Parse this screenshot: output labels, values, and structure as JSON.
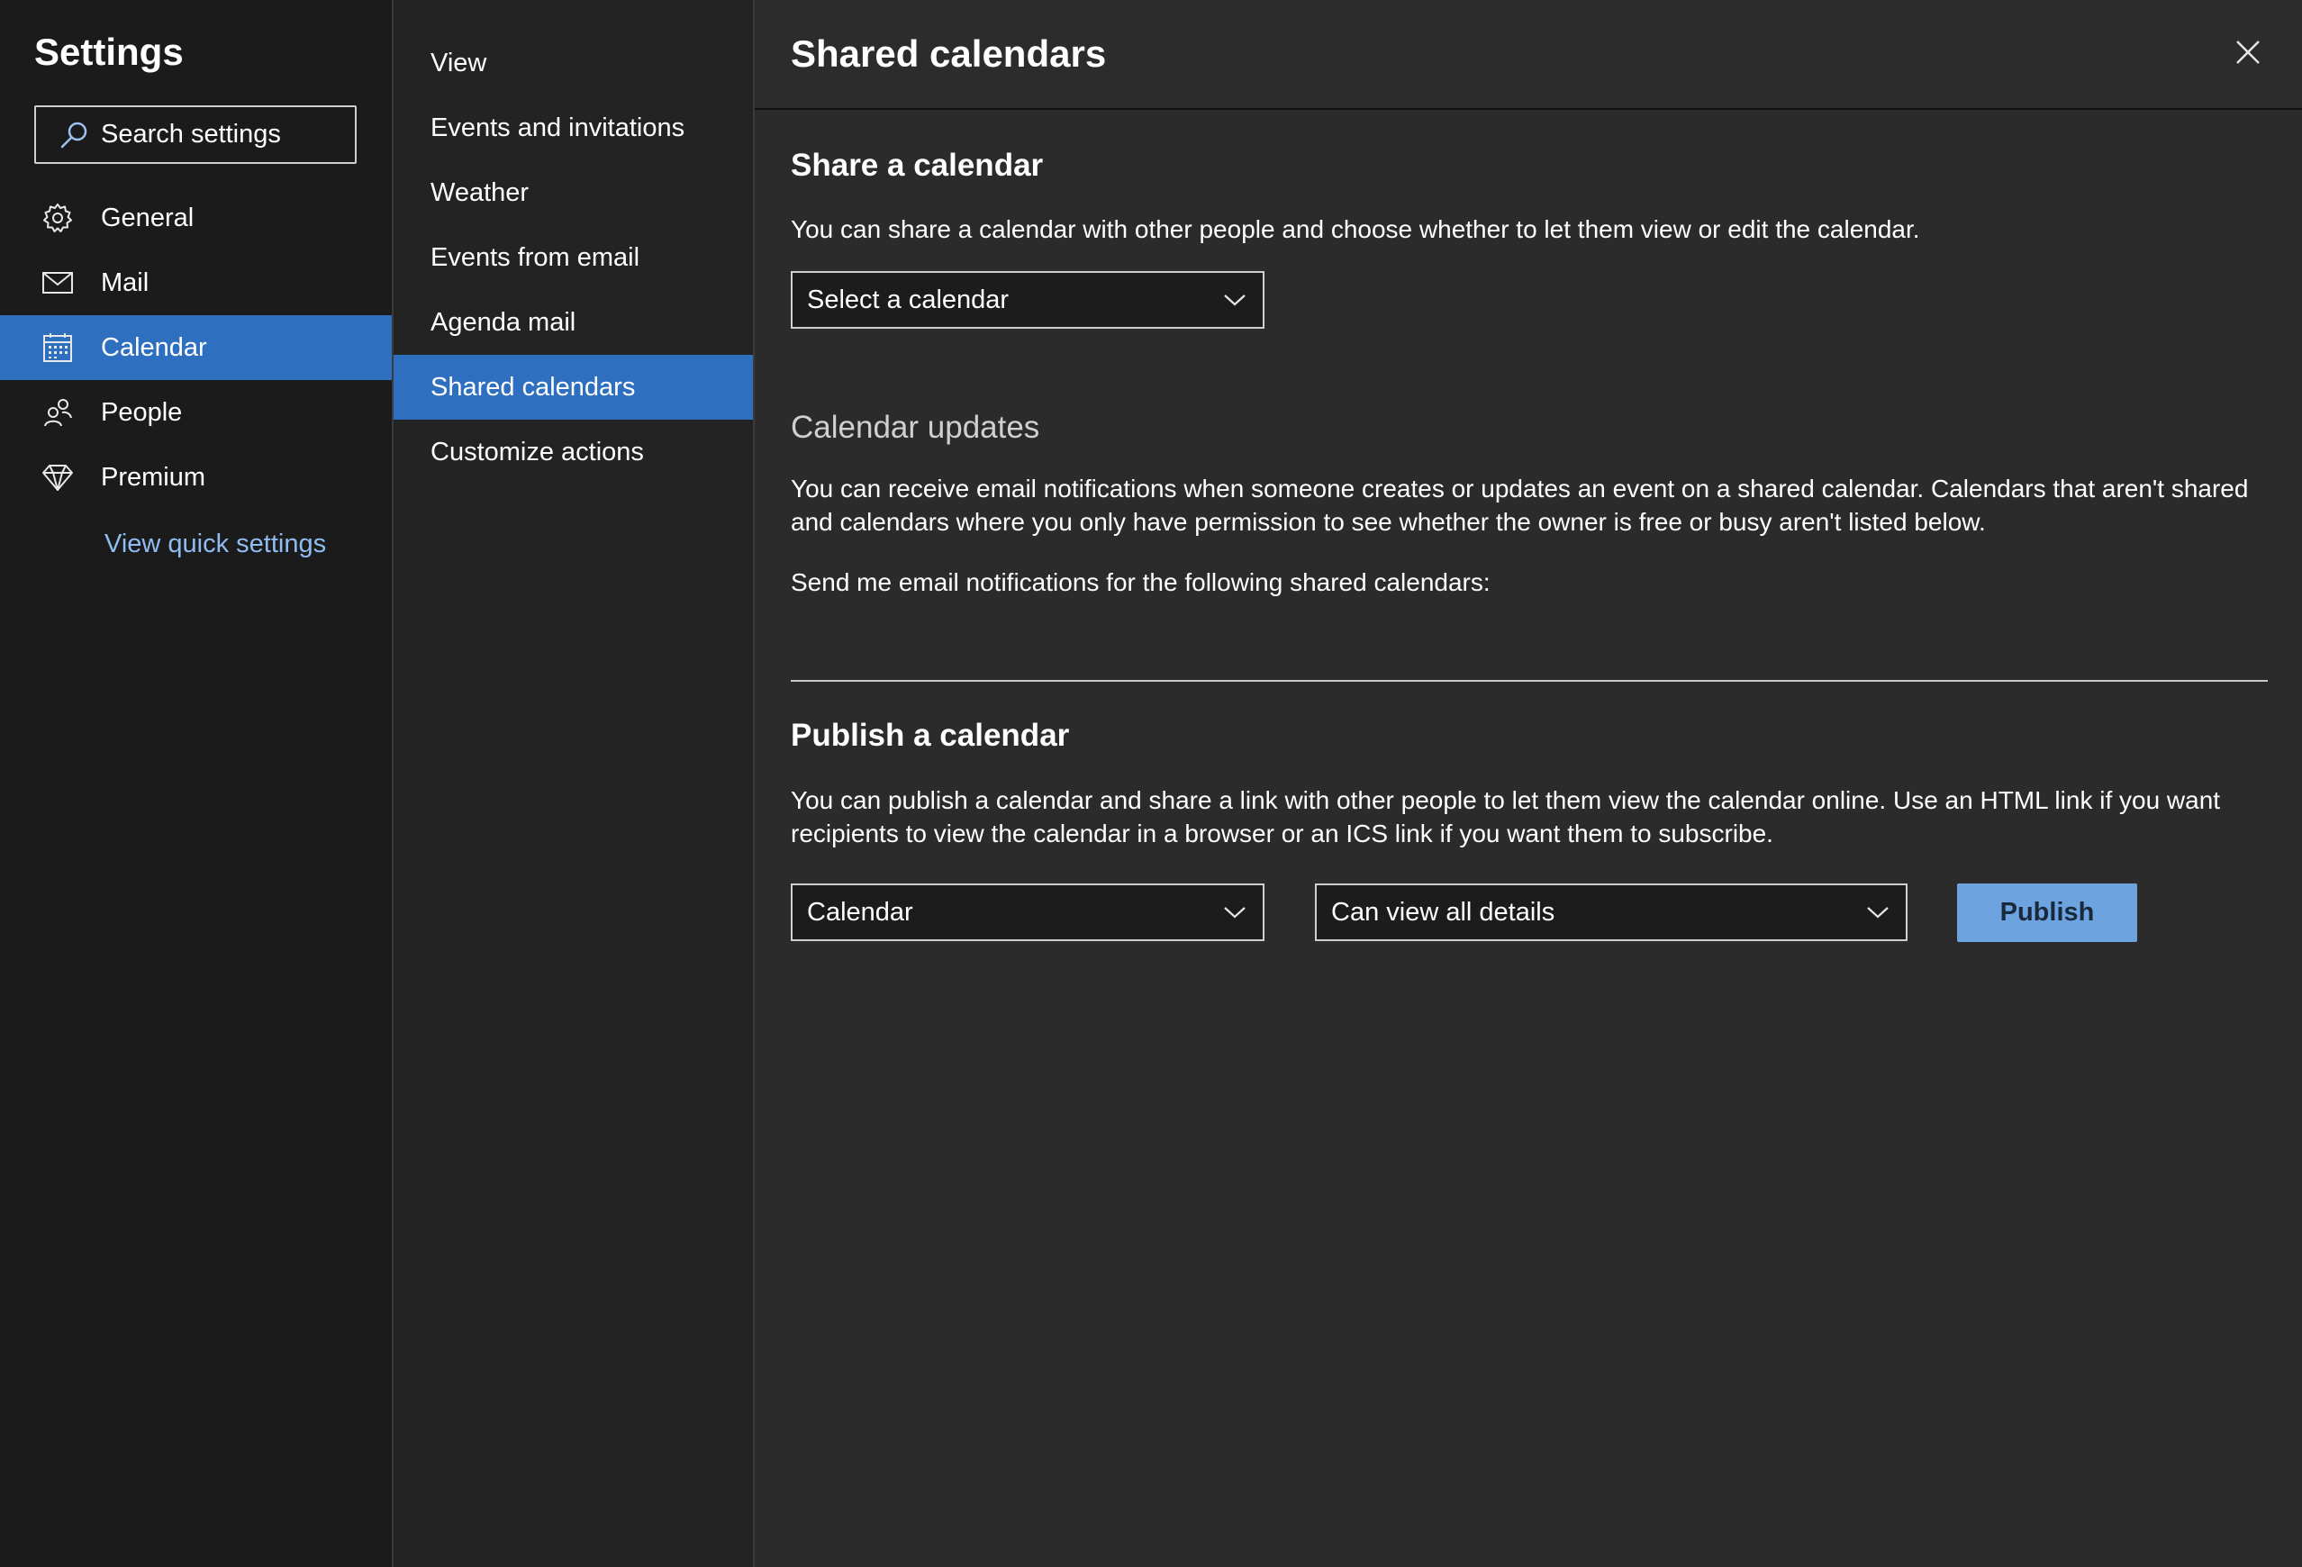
{
  "app": {
    "title": "Settings",
    "search_placeholder": "Search settings"
  },
  "nav": {
    "items": [
      {
        "label": "General",
        "icon": "gear-icon"
      },
      {
        "label": "Mail",
        "icon": "mail-icon"
      },
      {
        "label": "Calendar",
        "icon": "calendar-icon",
        "active": true
      },
      {
        "label": "People",
        "icon": "people-icon"
      },
      {
        "label": "Premium",
        "icon": "diamond-icon"
      }
    ],
    "quick_settings": "View quick settings"
  },
  "subnav": {
    "items": [
      {
        "label": "View"
      },
      {
        "label": "Events and invitations"
      },
      {
        "label": "Weather"
      },
      {
        "label": "Events from email"
      },
      {
        "label": "Agenda mail"
      },
      {
        "label": "Shared calendars",
        "active": true
      },
      {
        "label": "Customize actions"
      }
    ]
  },
  "pane": {
    "title": "Shared calendars",
    "share": {
      "heading": "Share a calendar",
      "description": "You can share a calendar with other people and choose whether to let them view or edit the calendar.",
      "select_value": "Select a calendar"
    },
    "updates": {
      "heading": "Calendar updates",
      "description": "You can receive email notifications when someone creates or updates an event on a shared calendar. Calendars that aren't shared and calendars where you only have permission to see whether the owner is free or busy aren't listed below.",
      "notify_label": "Send me email notifications for the following shared calendars:"
    },
    "publish": {
      "heading": "Publish a calendar",
      "description": "You can publish a calendar and share a link with other people to let them view the calendar online. Use an HTML link if you want recipients to view the calendar in a browser or an ICS link if you want them to subscribe.",
      "calendar_value": "Calendar",
      "permission_value": "Can view all details",
      "button_label": "Publish"
    }
  },
  "colors": {
    "accent": "#2f6fc0",
    "link": "#8fbdf2",
    "publish_button": "#6da4e0",
    "pane_bg": "#2b2b2b",
    "left_bg": "#1b1b1b"
  }
}
